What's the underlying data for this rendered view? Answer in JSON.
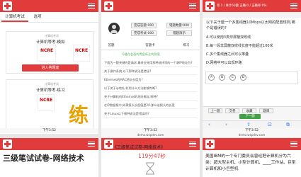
{
  "p1": {
    "tabs": [
      "计算机考试",
      "选项"
    ],
    "card1": {
      "label": "计算机考试",
      "title": "计算机等考-模拟",
      "button": "进入答题室"
    },
    "card2": {
      "label": "计算机考试",
      "title": "计算机等考-练习",
      "badge": "练"
    }
  },
  "p2": {
    "stats": [
      "完成答题:000",
      "错题数量:000",
      "完成考试:000",
      "错题演示"
    ],
    "tabs": [
      "答题",
      "答题卡",
      "练习"
    ],
    "notice": "6道在右面的黑色标注的答案",
    "items": [
      "下面为一题关键的是请求,最终应采用那种选择项的一个源IP地址为?",
      "关于操作系统,以下那种说法是错误?",
      "Ethernet的MAC地址长度为?",
      "以下关于ip地址,利用什么方法能够判断?",
      "关于计算机的Ethernet的地址概念,哪种?",
      "在IP数据报中,如果报头长度值是20,那么该报头的长度",
      "关于Linux以下哪种说法是错误的?"
    ]
  },
  "p3": {
    "header": "第 1 / 共计60题 正确:0 / 正确率:0%",
    "question": "以下关于建一个多集线器10Mbps以太网的配置规则,哪个是错误的?",
    "options": [
      "A.可以使用3类非屏蔽双绞线",
      "B.每一段非屏蔽双绞线长度不能超过100米",
      "C.多个集线器之间可以堆叠",
      "D.网络中可以出现环路"
    ],
    "answers": [
      "A",
      "B",
      "C",
      "D"
    ],
    "bottom": [
      "上一题",
      "交卷",
      "收藏",
      "题目",
      "下一题"
    ],
    "status_time": "下午3:52",
    "url": "demo.wxpdev.com"
  },
  "p4": {
    "title": "《三级笔试试卷-网络技术》",
    "timer": "119分47秒",
    "status_time": "下午3:52",
    "url": "demo.wxpdev.com"
  },
  "p5": {
    "big_title": "三级笔试试卷-网络技术",
    "status_time": "下午3:52",
    "url": "demo.wxpdev.com"
  },
  "p6": {
    "text": "美国IBM的一个专门委员会曾经把计算机分为六类：超大型主机、小型计算机、____工作站、巨型计算机和小巨型机",
    "status_time": "下午3:52",
    "url": "demo.wxpdev.com"
  }
}
